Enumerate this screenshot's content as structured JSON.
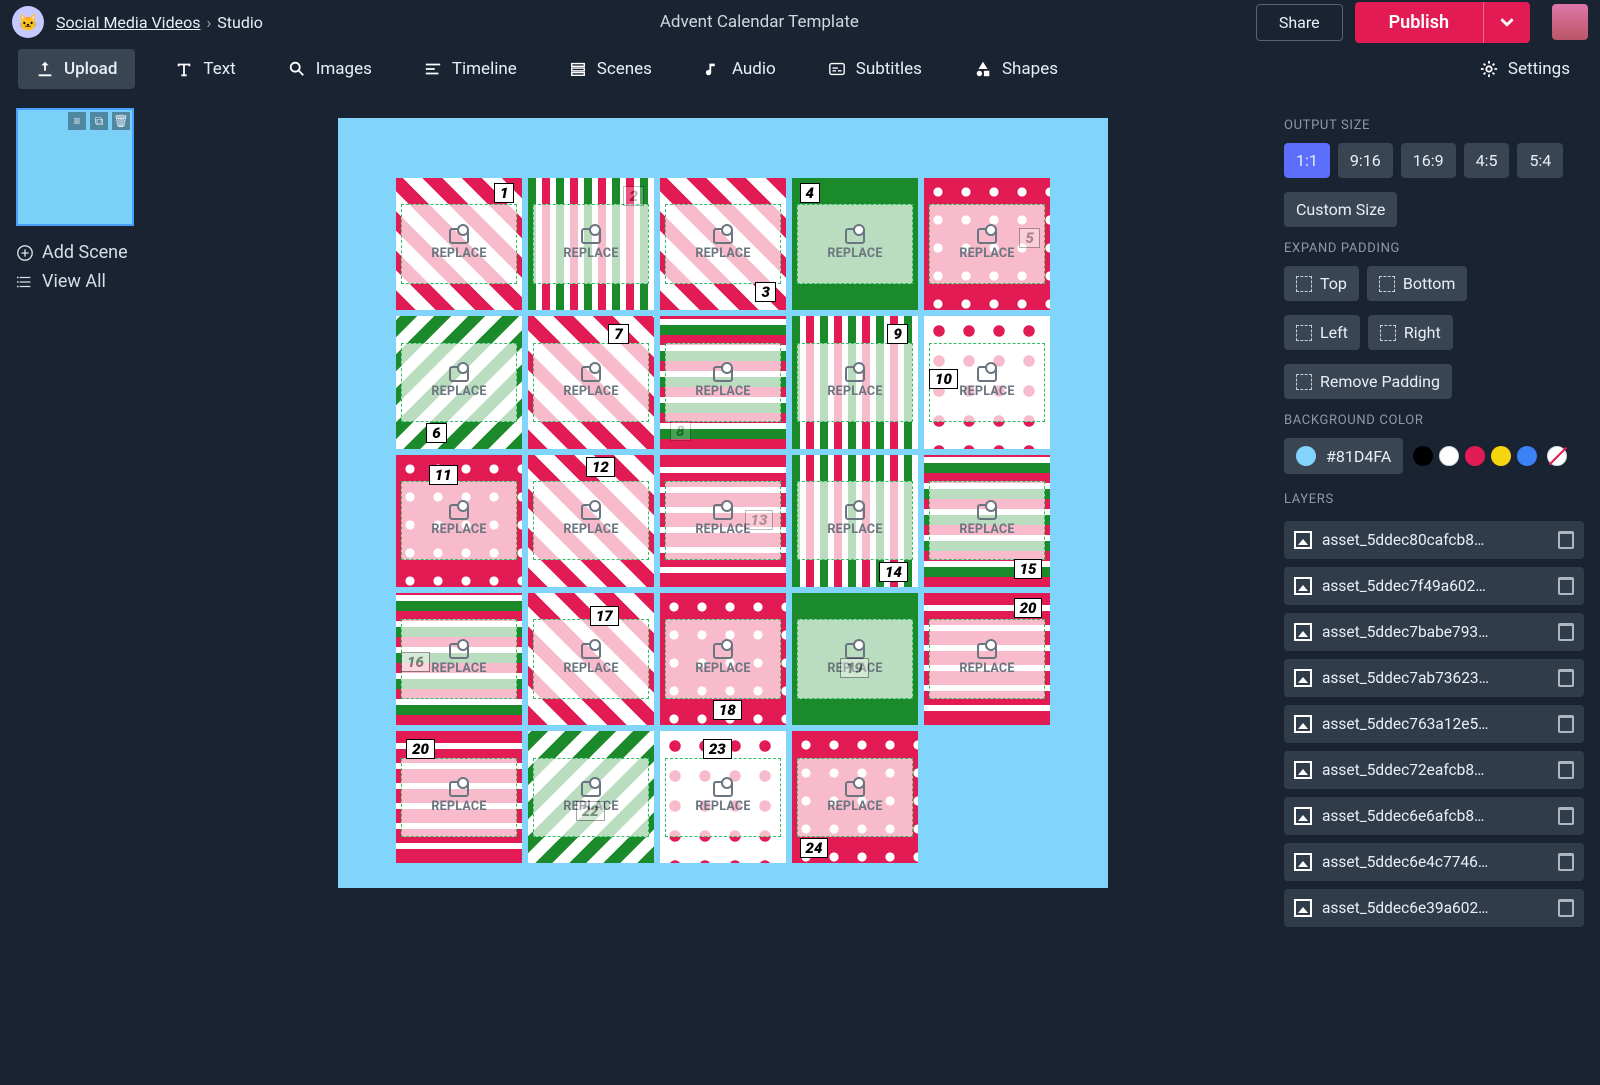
{
  "breadcrumb": {
    "workspace": "Social Media Videos",
    "separator": "›",
    "current": "Studio"
  },
  "project_title": "Advent Calendar Template",
  "topbar": {
    "share": "Share",
    "publish": "Publish"
  },
  "toolbar": {
    "upload": "Upload",
    "text": "Text",
    "images": "Images",
    "timeline": "Timeline",
    "scenes": "Scenes",
    "audio": "Audio",
    "subtitles": "Subtitles",
    "shapes": "Shapes",
    "settings": "Settings"
  },
  "left": {
    "add_scene": "Add Scene",
    "view_all": "View All"
  },
  "canvas": {
    "replace_label": "REPLACE",
    "background_hex": "#81D4FA",
    "cells": [
      {
        "day": 1,
        "pat": "patA",
        "pos": "top:4%;right:6%"
      },
      {
        "day": 2,
        "pat": "patB",
        "pos": "top:6%;right:8%;opacity:.25"
      },
      {
        "day": 3,
        "pat": "patA",
        "pos": "bottom:6%;right:8%"
      },
      {
        "day": 4,
        "pat": "patD",
        "pos": "top:4%;left:6%"
      },
      {
        "day": 5,
        "pat": "patC",
        "pos": "top:38%;right:8%;opacity:.3"
      },
      {
        "day": 6,
        "pat": "patE",
        "pos": "bottom:4%;left:24%"
      },
      {
        "day": 7,
        "pat": "patA",
        "pos": "top:6%;right:20%"
      },
      {
        "day": 8,
        "pat": "patF",
        "pos": "bottom:6%;left:8%;opacity:.2"
      },
      {
        "day": 9,
        "pat": "patB",
        "pos": "top:6%;right:8%"
      },
      {
        "day": 10,
        "pat": "patG",
        "pos": "top:40%;left:4%"
      },
      {
        "day": 11,
        "pat": "patC",
        "pos": "top:8%;left:26%"
      },
      {
        "day": 12,
        "pat": "patA",
        "pos": "top:2%;left:46%"
      },
      {
        "day": 13,
        "pat": "patH",
        "pos": "top:42%;right:10%;opacity:.25"
      },
      {
        "day": 14,
        "pat": "patB",
        "pos": "bottom:4%;right:8%"
      },
      {
        "day": 15,
        "pat": "patF",
        "pos": "bottom:6%;right:6%"
      },
      {
        "day": 16,
        "pat": "patF",
        "pos": "bottom:40%;left:4%;opacity:.4"
      },
      {
        "day": 17,
        "pat": "patA",
        "pos": "top:10%;right:28%"
      },
      {
        "day": 18,
        "pat": "patC",
        "pos": "bottom:4%;left:42%"
      },
      {
        "day": 19,
        "pat": "patD",
        "pos": "bottom:36%;left:38%;opacity:.35"
      },
      {
        "day": 20,
        "pat": "patH",
        "pos": "top:4%;right:6%"
      },
      {
        "day": 20,
        "pat": "patH",
        "pos": "top:6%;left:8%"
      },
      {
        "day": 22,
        "pat": "patE",
        "pos": "bottom:32%;left:38%;opacity:.35"
      },
      {
        "day": 23,
        "pat": "patG",
        "pos": "top:6%;left:34%"
      },
      {
        "day": 24,
        "pat": "patC",
        "pos": "bottom:4%;left:6%"
      }
    ]
  },
  "right": {
    "output_size_label": "OUTPUT SIZE",
    "ratios": [
      "1:1",
      "9:16",
      "16:9",
      "4:5",
      "5:4"
    ],
    "ratio_selected": "1:1",
    "custom_size": "Custom Size",
    "expand_padding_label": "EXPAND PADDING",
    "padding": {
      "top": "Top",
      "bottom": "Bottom",
      "left": "Left",
      "right": "Right",
      "remove": "Remove Padding"
    },
    "background_color_label": "BACKGROUND COLOR",
    "bg_hex": "#81D4FA",
    "swatches": [
      "#000000",
      "#ffffff",
      "#e31b54",
      "#f6d50e",
      "#3b82f6"
    ],
    "layers_label": "LAYERS",
    "layers": [
      "asset_5ddec80cafcb8…",
      "asset_5ddec7f49a602…",
      "asset_5ddec7babe793…",
      "asset_5ddec7ab73623…",
      "asset_5ddec763a12e5…",
      "asset_5ddec72eafcb8…",
      "asset_5ddec6e6afcb8…",
      "asset_5ddec6e4c7746…",
      "asset_5ddec6e39a602…"
    ]
  }
}
